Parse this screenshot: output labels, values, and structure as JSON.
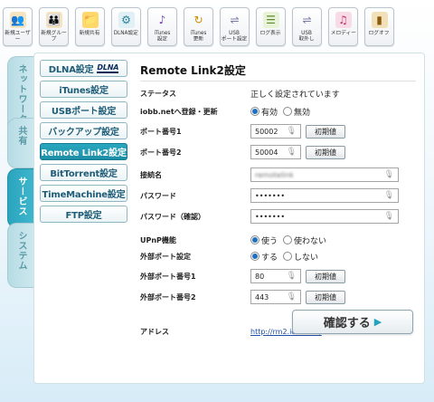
{
  "toolbar": {
    "buttons": [
      {
        "label": "新規ユーザー",
        "icon": "user-add-icon"
      },
      {
        "label": "新規グループ",
        "icon": "group-add-icon"
      },
      {
        "label": "新規共有",
        "icon": "folder-share-icon"
      },
      {
        "label": "DLNA設定",
        "icon": "dlna-settings-icon"
      },
      {
        "label": "iTunes\n設定",
        "icon": "itunes-settings-icon"
      },
      {
        "label": "iTunes\n更新",
        "icon": "itunes-update-icon"
      },
      {
        "label": "USB\nポート設定",
        "icon": "usb-port-icon"
      },
      {
        "label": "ログ表示",
        "icon": "log-view-icon"
      },
      {
        "label": "USB\n取外し",
        "icon": "usb-remove-icon"
      },
      {
        "label": "メロディー",
        "icon": "melody-icon"
      },
      {
        "label": "ログオフ",
        "icon": "logoff-icon"
      }
    ]
  },
  "side_tabs": [
    {
      "label": "ネットワーク",
      "active": false
    },
    {
      "label": "共有",
      "active": false
    },
    {
      "label": "サービス",
      "active": true
    },
    {
      "label": "システム",
      "active": false
    }
  ],
  "sub_nav": [
    {
      "label": "DLNA設定",
      "logo": "DLNA"
    },
    {
      "label": "iTunes設定"
    },
    {
      "label": "USBポート設定"
    },
    {
      "label": "バックアップ設定"
    },
    {
      "label": "Remote Link2設定",
      "active": true
    },
    {
      "label": "BitTorrent設定"
    },
    {
      "label": "TimeMachine設定"
    },
    {
      "label": "FTP設定"
    }
  ],
  "page": {
    "title": "Remote Link2設定",
    "status_label": "ステータス",
    "status_value": "正しく設定されています",
    "iobb_label": "iobb.netへ登録・更新",
    "iobb_on": "有効",
    "iobb_off": "無効",
    "port1_label": "ポート番号1",
    "port1_value": "50002",
    "port2_label": "ポート番号2",
    "port2_value": "50004",
    "default_button": "初期値",
    "conn_label": "接続名",
    "conn_value": "remotelink",
    "password_label": "パスワード",
    "password_value": "•••••••",
    "password_confirm_label": "パスワード（確認）",
    "password_confirm_value": "•••••••",
    "upnp_label": "UPnP機能",
    "upnp_on": "使う",
    "upnp_off": "使わない",
    "ext_port_label": "外部ポート設定",
    "ext_port_on": "する",
    "ext_port_off": "しない",
    "ext_port1_label": "外部ポート番号1",
    "ext_port1_value": "80",
    "ext_port2_label": "外部ポート番号2",
    "ext_port2_value": "443",
    "address_label": "アドレス",
    "address_value": "http://rm2.iobb.net/",
    "confirm_button": "確認する"
  }
}
